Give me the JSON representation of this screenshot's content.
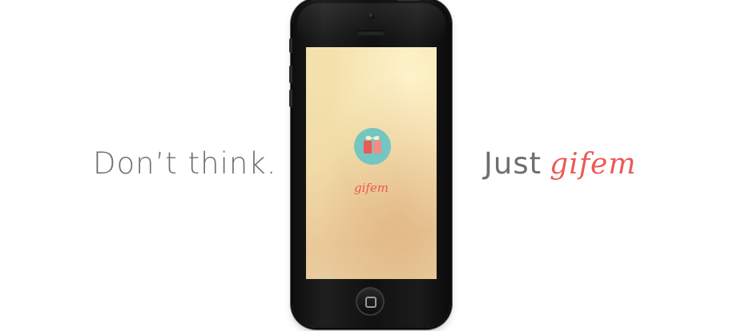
{
  "tagline": {
    "left_text": "Don’t think.",
    "right_prefix": "Just",
    "right_brand": "gifem"
  },
  "app": {
    "name": "gifem",
    "icon": "gift-icon"
  },
  "phone": {
    "home_icon": "home-button-square-icon"
  },
  "colors": {
    "brand": "#ec5a55",
    "icon_background": "#74c6c0",
    "text_gray": "#6f6f6f",
    "phone_body": "#111111"
  }
}
